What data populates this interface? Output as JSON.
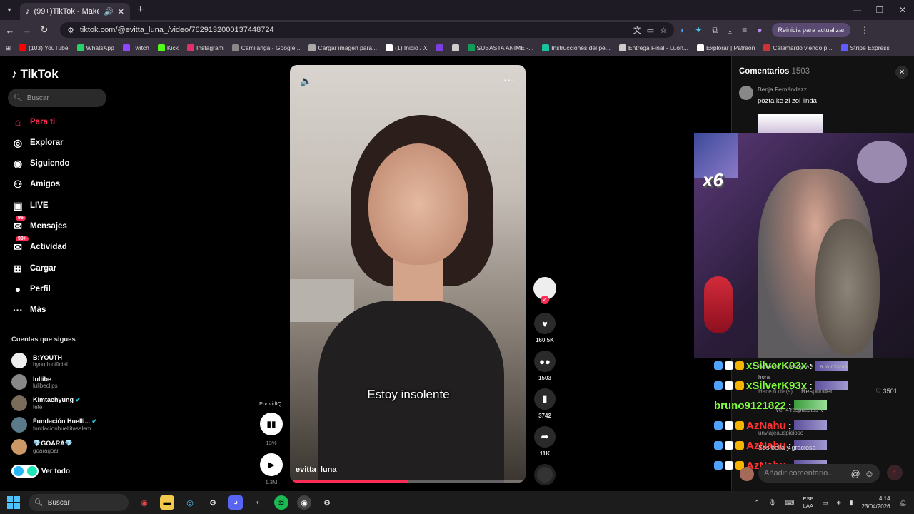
{
  "browser": {
    "tab_title": "(99+)TikTok - Make Your D",
    "url": "tiktok.com/@evitta_luna_/video/7629132000137448724",
    "update_button": "Reinicia para actualizar",
    "bookmarks": [
      {
        "label": "(103) YouTube",
        "color": "#ff0000"
      },
      {
        "label": "WhatsApp",
        "color": "#25d366"
      },
      {
        "label": "Twitch",
        "color": "#9146ff"
      },
      {
        "label": "Kick",
        "color": "#53fc18"
      },
      {
        "label": "Instagram",
        "color": "#e1306c"
      },
      {
        "label": "Camilanga - Google...",
        "color": "#888888"
      },
      {
        "label": "Cargar imagen para...",
        "color": "#aaaaaa"
      },
      {
        "label": "(1) Inicio / X",
        "color": "#ffffff"
      },
      {
        "label": "",
        "color": "#7b3fe4"
      },
      {
        "label": "",
        "color": "#cccccc"
      },
      {
        "label": "SUBASTA ANIME -...",
        "color": "#0f9d58"
      },
      {
        "label": "Instrucciones del pe...",
        "color": "#19c3a0"
      },
      {
        "label": "Entrega Final - Luon...",
        "color": "#cccccc"
      },
      {
        "label": "Explorar | Patreon",
        "color": "#ffffff"
      },
      {
        "label": "Calamardo viendo p...",
        "color": "#cc3333"
      },
      {
        "label": "Stripe Express",
        "color": "#635bff"
      }
    ]
  },
  "sidebar": {
    "logo": "TikTok",
    "search_placeholder": "Buscar",
    "nav": [
      {
        "label": "Para ti",
        "icon": "home-icon",
        "active": true
      },
      {
        "label": "Explorar",
        "icon": "compass-icon"
      },
      {
        "label": "Siguiendo",
        "icon": "following-icon"
      },
      {
        "label": "Amigos",
        "icon": "friends-icon"
      },
      {
        "label": "LIVE",
        "icon": "live-icon"
      },
      {
        "label": "Mensajes",
        "icon": "messages-icon",
        "badge": "95"
      },
      {
        "label": "Actividad",
        "icon": "activity-icon",
        "badge": "99+"
      },
      {
        "label": "Cargar",
        "icon": "upload-icon"
      },
      {
        "label": "Perfil",
        "icon": "profile-icon"
      },
      {
        "label": "Más",
        "icon": "more-icon"
      }
    ],
    "following_title": "Cuentas que sigues",
    "accounts": [
      {
        "name": "B:YOUTH",
        "handle": "byouth.official"
      },
      {
        "name": "luliibe",
        "handle": "lulibeclips"
      },
      {
        "name": "Kimtaehyung",
        "handle": "tete",
        "verified": true
      },
      {
        "name": "Fundación Huelli...",
        "handle": "fundacionhuellitasalem...",
        "verified": true
      },
      {
        "name": "💎GOARA💎",
        "handle": "goaragoar"
      }
    ],
    "see_all": "Ver todo"
  },
  "video": {
    "subtitle": "Estoy insolente",
    "author": "evitta_luna_",
    "progress": 0.5
  },
  "actions": {
    "likes": "160.5K",
    "comments": "1503",
    "saves": "3742",
    "shares": "11K"
  },
  "vidiq": {
    "label": "Por vidIQ",
    "percent": "13%",
    "views": "1.3M"
  },
  "comments": {
    "title": "Comentarios",
    "count": "1503",
    "first": {
      "user": "Benja Fernándezz",
      "text": "pozta ke zi zoi linda"
    },
    "overlay_badge": "x6",
    "chat": [
      {
        "name": "xSilverK93x",
        "color": "#7fff3b"
      },
      {
        "name": "xSilverK93x",
        "color": "#7fff3b"
      },
      {
        "name": "bruno9121822",
        "color": "#7fff3b"
      },
      {
        "name": "AzNahu",
        "color": "#ff3232"
      },
      {
        "name": "AzNahu",
        "color": "#ff3232"
      },
      {
        "name": "AzNahu",
        "color": "#ff3232"
      }
    ],
    "behind": {
      "line1": "la fila del humor y la s... a la misma",
      "line2": "hora",
      "meta_time": "Hace 6 día(s)",
      "reply": "Responder",
      "likes": "3501",
      "more_replies": "Ver 4 respuestas",
      "user2": "unviajeauspicioso",
      "text2": "Sos bella y graciosa"
    },
    "input_placeholder": "Añadir comentario..."
  },
  "taskbar": {
    "search": "Buscar",
    "lang1": "ESP",
    "lang2": "LAA",
    "time": "4:14",
    "date": "23/04/2026"
  }
}
